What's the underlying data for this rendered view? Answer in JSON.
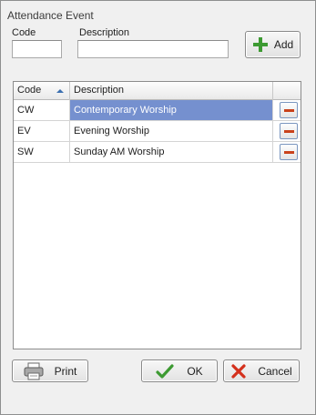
{
  "window": {
    "title": "Attendance Event"
  },
  "form": {
    "code_label": "Code",
    "description_label": "Description",
    "code_value": "",
    "description_value": "",
    "add_label": "Add"
  },
  "grid": {
    "columns": [
      {
        "label": "Code",
        "sort": "ascending"
      },
      {
        "label": "Description"
      }
    ],
    "rows": [
      {
        "code": "CW",
        "description": "Contemporary Worship",
        "selected": true
      },
      {
        "code": "EV",
        "description": "Evening Worship",
        "selected": false
      },
      {
        "code": "SW",
        "description": "Sunday AM Worship",
        "selected": false
      }
    ]
  },
  "buttons": {
    "print_label": "Print",
    "ok_label": "OK",
    "cancel_label": "Cancel"
  },
  "colors": {
    "selection": "#7590cf",
    "remove": "#c9421b",
    "add_icon": "#3d9a32",
    "ok_icon": "#3d9a32",
    "cancel_icon": "#d4301c"
  },
  "icons": [
    "plus-icon",
    "minus-icon",
    "sort-up-icon",
    "printer-icon",
    "checkmark-icon",
    "x-icon"
  ]
}
